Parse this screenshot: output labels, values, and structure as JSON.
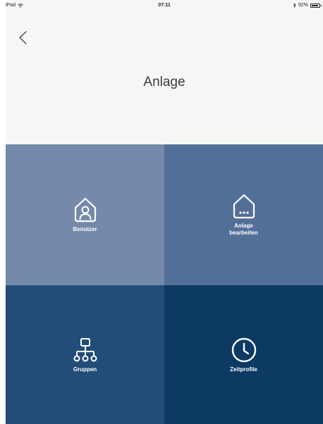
{
  "status_bar": {
    "device": "iPad",
    "time": "07:11",
    "battery": "92%",
    "battery_level": 0.92
  },
  "header": {
    "back_icon": "chevron-left-icon",
    "title": "Anlage"
  },
  "tiles": [
    {
      "label": "Benutzer",
      "icon": "user-house-icon",
      "color": "#758aab"
    },
    {
      "label": "Anlage\nbearbeiten",
      "icon": "house-dots-icon",
      "color": "#526f98"
    },
    {
      "label": "Gruppen",
      "icon": "hierarchy-icon",
      "color": "#234d79"
    },
    {
      "label": "Zeitprofile",
      "icon": "clock-icon",
      "color": "#0d3a63"
    }
  ]
}
